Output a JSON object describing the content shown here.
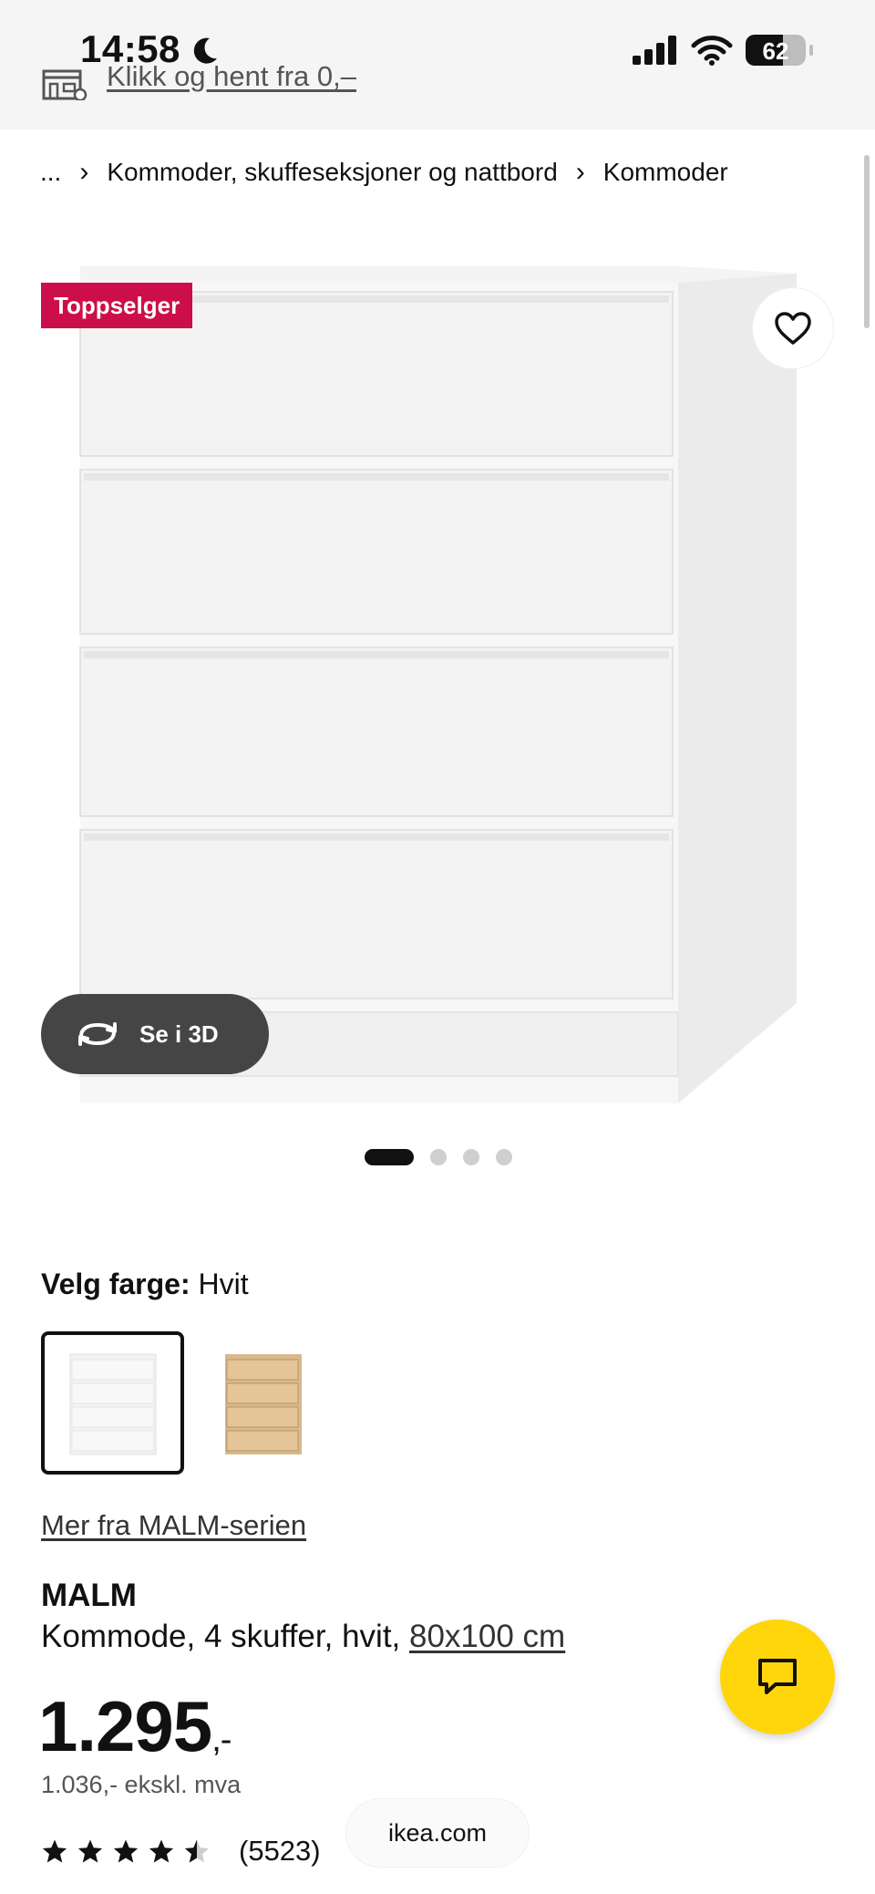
{
  "status_bar": {
    "time": "14:58",
    "battery": "62"
  },
  "top_banner": {
    "pickup_text": "Klikk og hent fra 0,–"
  },
  "breadcrumb": {
    "ellipsis": "...",
    "category": "Kommoder, skuffeseksjoner og nattbord",
    "current": "Kommoder"
  },
  "image": {
    "badge": "Toppselger",
    "view3d_label": "Se i 3D",
    "carousel_count": 4,
    "carousel_active": 0
  },
  "color": {
    "label": "Velg farge:",
    "selected": "Hvit",
    "options": [
      "Hvit",
      "Hvitbeiset eik"
    ]
  },
  "series_link": "Mer fra MALM-serien",
  "product": {
    "name": "MALM",
    "description": "Kommode, 4 skuffer, hvit,",
    "size": "80x100 cm",
    "price": "1.295",
    "price_suffix": ",-",
    "price_ex_vat": "1.036,- ekskl. mva",
    "rating": 4.5,
    "review_count": "(5523)"
  },
  "browser": {
    "url": "ikea.com"
  },
  "colors": {
    "badge": "#cc0e4a",
    "chat": "#ffd60a",
    "pill": "#454545"
  },
  "icons": [
    "moon-icon",
    "signal-icon",
    "wifi-icon",
    "battery-icon",
    "store-icon",
    "heart-icon",
    "rotate-3d-icon",
    "chat-icon",
    "star-icon"
  ]
}
